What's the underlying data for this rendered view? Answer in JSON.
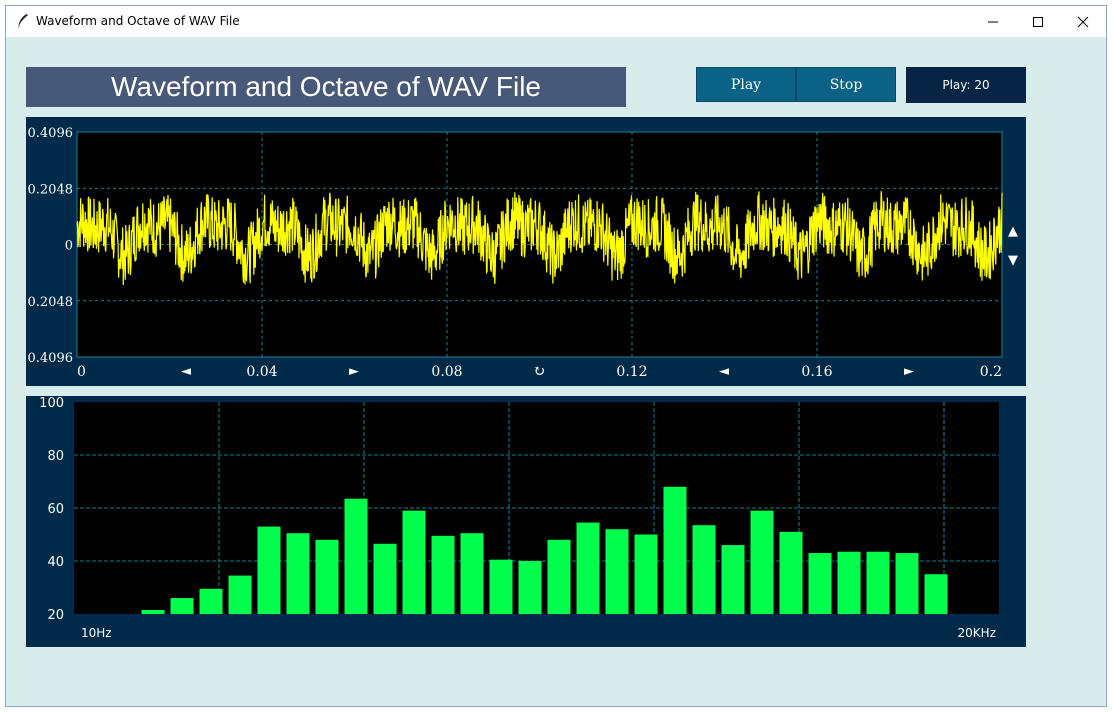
{
  "window": {
    "title": "Waveform and Octave of WAV File",
    "minimize_icon": "minimize-icon",
    "maximize_icon": "maximize-icon",
    "close_icon": "close-icon"
  },
  "header": {
    "banner": "Waveform and Octave of WAV File",
    "play_label": "Play",
    "stop_label": "Stop",
    "status": "Play: 20"
  },
  "colors": {
    "waveform": "#ffff00",
    "bars": "#00ff4c",
    "grid": "#1aa3b8",
    "panel": "#002a4a",
    "plot_bg": "#000000"
  },
  "waveform": {
    "y_ticks": [
      "0.4096",
      "0.2048",
      "0",
      "0.2048",
      "0.4096"
    ],
    "x_ticks": [
      "0",
      "0.04",
      "0.08",
      "0.12",
      "0.16",
      "0.2"
    ],
    "controls": {
      "pan_left_1": "◄",
      "pan_right_1": "►",
      "reset": "↻",
      "pan_left_2": "◄",
      "pan_right_2": "►",
      "scroll_up": "▲",
      "scroll_down": "▼"
    }
  },
  "chart_data": [
    {
      "type": "line",
      "xlim": [
        0,
        0.2
      ],
      "ylim": [
        -0.4096,
        0.4096
      ],
      "grid": true,
      "description_free": true,
      "x": [
        0,
        0.02,
        0.04,
        0.06,
        0.08,
        0.1,
        0.12,
        0.14,
        0.16,
        0.18,
        0.2
      ],
      "y": [
        0.04,
        0.02,
        0.05,
        0.03,
        0.03,
        0.04,
        0.02,
        0.03,
        0.02,
        0.01,
        0.03
      ],
      "amplitude_range": [
        -0.2,
        0.24
      ],
      "period_seconds": 0.0133
    },
    {
      "type": "bar",
      "ylim": [
        20,
        100
      ],
      "yticks": [
        "100",
        "80",
        "60",
        "40",
        "20"
      ],
      "x_first_label": "10Hz",
      "x_last_label": "20KHz",
      "grid": true,
      "values": [
        0,
        0,
        21.5,
        26,
        29.5,
        34.5,
        53,
        50.5,
        48,
        63.5,
        46.5,
        59,
        49.5,
        50.5,
        40.5,
        40,
        48,
        54.5,
        52,
        50,
        68,
        53.5,
        46,
        59,
        51,
        43,
        43.5,
        43.5,
        43,
        35,
        0
      ]
    }
  ]
}
